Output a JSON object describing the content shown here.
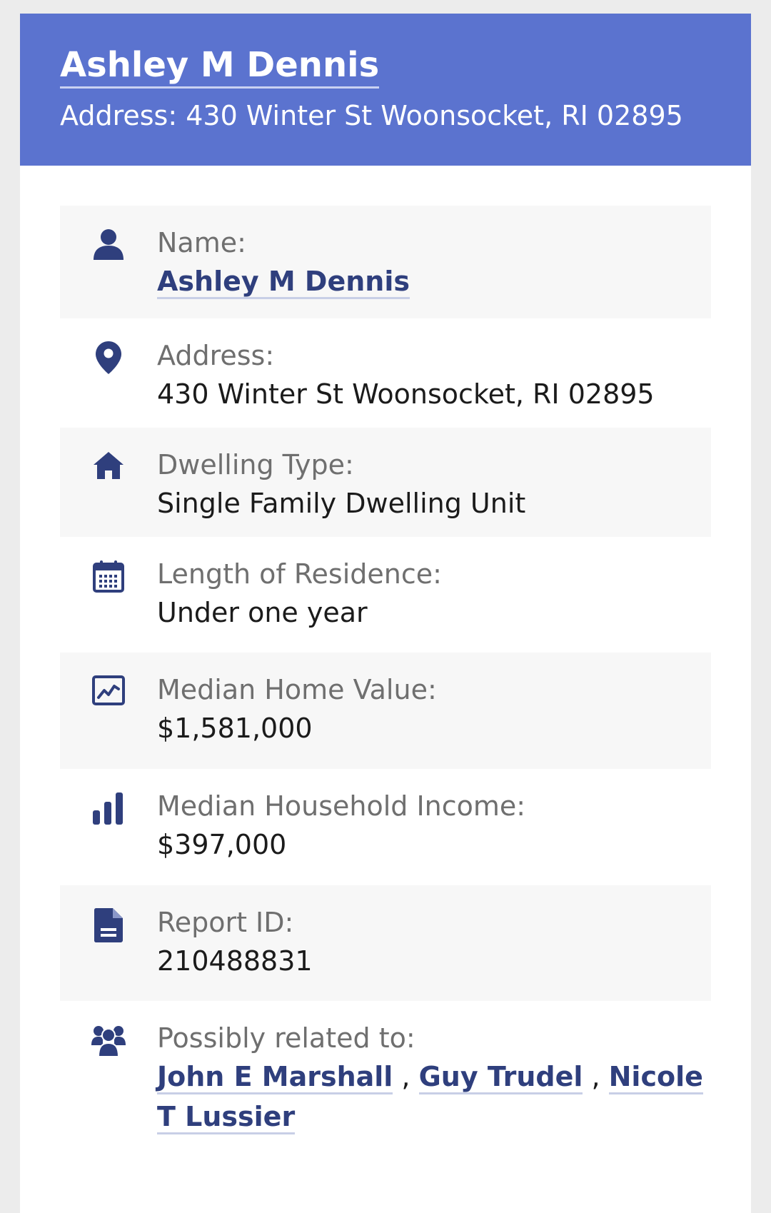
{
  "header": {
    "name": "Ashley M Dennis",
    "address": "Address: 430 Winter St Woonsocket, RI 02895"
  },
  "fields": {
    "name": {
      "label": "Name:",
      "value": "Ashley M Dennis",
      "icon": "person-icon"
    },
    "address": {
      "label": "Address:",
      "value": "430 Winter St Woonsocket, RI 02895",
      "icon": "map-pin-icon"
    },
    "dwelling": {
      "label": "Dwelling Type:",
      "value": "Single Family Dwelling Unit",
      "icon": "home-icon"
    },
    "residence": {
      "label": "Length of Residence:",
      "value": "Under one year",
      "icon": "calendar-icon"
    },
    "home_value": {
      "label": "Median Home Value:",
      "value": "$1,581,000",
      "icon": "line-chart-icon"
    },
    "income": {
      "label": "Median Household Income:",
      "value": "$397,000",
      "icon": "bar-chart-icon"
    },
    "report": {
      "label": "Report ID:",
      "value": "210488831",
      "icon": "document-icon"
    },
    "related": {
      "label": "Possibly related to:",
      "icon": "users-icon",
      "people": [
        "John E Marshall",
        "Guy Trudel",
        "Nicole T Lussier"
      ],
      "separator": ","
    }
  },
  "colors": {
    "header_bg": "#5b73cf",
    "icon": "#2f3f7d",
    "link": "#2f3f7d",
    "alt_row": "#f7f7f7"
  }
}
